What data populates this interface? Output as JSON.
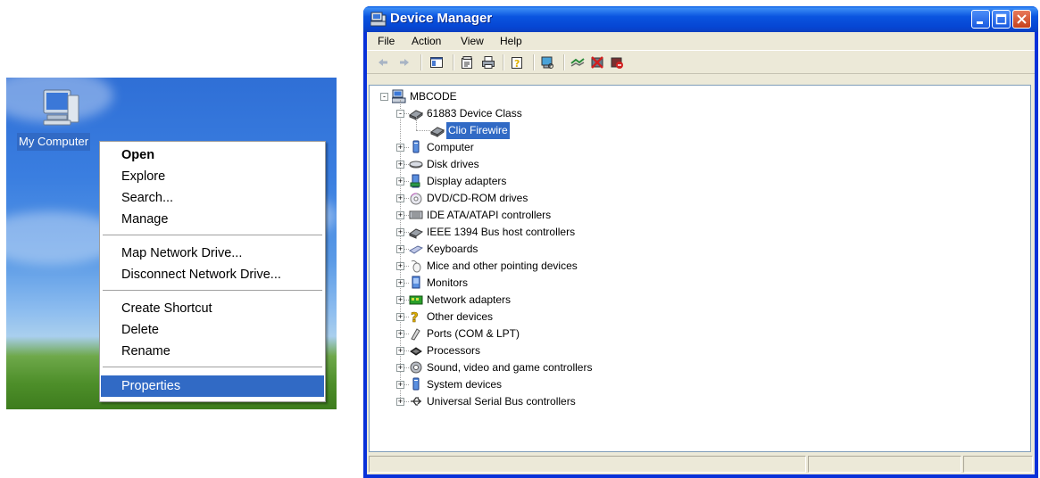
{
  "desktop": {
    "icon_label": "My Computer",
    "context_menu": {
      "items": [
        {
          "label": "Open",
          "bold": true
        },
        {
          "label": "Explore"
        },
        {
          "label": "Search..."
        },
        {
          "label": "Manage"
        },
        {
          "label": "Map Network Drive..."
        },
        {
          "label": "Disconnect Network Drive..."
        },
        {
          "label": "Create Shortcut"
        },
        {
          "label": "Delete"
        },
        {
          "label": "Rename"
        },
        {
          "label": "Properties",
          "selected": true
        }
      ]
    }
  },
  "window": {
    "title": "Device Manager",
    "menu": [
      "File",
      "Action",
      "View",
      "Help"
    ],
    "toolbar_icons": [
      "back-icon",
      "forward-icon",
      "console-tree-icon",
      "properties-icon",
      "print-icon",
      "help-icon",
      "scan-hardware-icon",
      "update-driver-icon",
      "uninstall-icon",
      "disable-icon"
    ],
    "tree": {
      "root": "MBCODE",
      "items": [
        {
          "label": "61883 Device Class",
          "icon": "device-class-icon",
          "expanded": true,
          "children": [
            {
              "label": "Clio Firewire",
              "icon": "device-class-icon",
              "selected": true
            }
          ]
        },
        {
          "label": "Computer",
          "icon": "computer-icon"
        },
        {
          "label": "Disk drives",
          "icon": "disk-drive-icon"
        },
        {
          "label": "Display adapters",
          "icon": "display-adapter-icon"
        },
        {
          "label": "DVD/CD-ROM drives",
          "icon": "cdrom-icon"
        },
        {
          "label": "IDE ATA/ATAPI controllers",
          "icon": "ide-controller-icon"
        },
        {
          "label": "IEEE 1394 Bus host controllers",
          "icon": "ieee1394-icon"
        },
        {
          "label": "Keyboards",
          "icon": "keyboard-icon"
        },
        {
          "label": "Mice and other pointing devices",
          "icon": "mouse-icon"
        },
        {
          "label": "Monitors",
          "icon": "monitor-icon"
        },
        {
          "label": "Network adapters",
          "icon": "network-adapter-icon"
        },
        {
          "label": "Other devices",
          "icon": "unknown-device-icon"
        },
        {
          "label": "Ports (COM & LPT)",
          "icon": "port-icon"
        },
        {
          "label": "Processors",
          "icon": "processor-icon"
        },
        {
          "label": "Sound, video and game controllers",
          "icon": "sound-icon"
        },
        {
          "label": "System devices",
          "icon": "system-device-icon"
        },
        {
          "label": "Universal Serial Bus controllers",
          "icon": "usb-icon"
        }
      ]
    },
    "colors": {
      "selection": "#316ac5",
      "title_bar": "#0a54e0",
      "face": "#ece9d8"
    }
  }
}
